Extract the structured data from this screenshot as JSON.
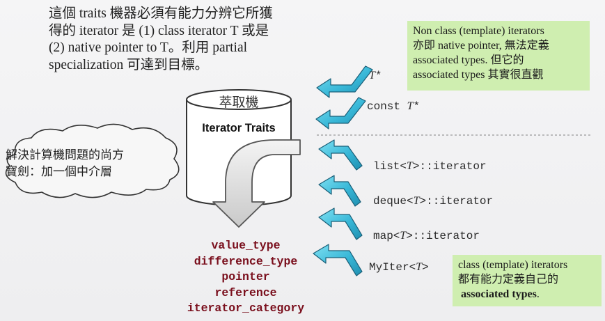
{
  "intro": {
    "lines": [
      "這個 traits 機器必須有能力分辨它所獲",
      "得的 iterator 是 (1) class iterator T 或是",
      "(2) native pointer to T。利用 partial",
      "specialization 可達到目標。"
    ]
  },
  "note_top": {
    "lines": [
      "Non class (template) iterators",
      "亦即 native pointer, 無法定義",
      "associated types. 但它的",
      "associated types 其實很直觀"
    ]
  },
  "note_bottom": {
    "line1": "class (template) iterators",
    "line2": "都有能力定義自己的",
    "line3_bold": "associated types",
    "line3_end": "."
  },
  "cylinder": {
    "title": "萃取機",
    "name": "Iterator Traits"
  },
  "cloud": {
    "lines": [
      "解決計算機問題的尚方",
      "寶劍：加一個中介層"
    ]
  },
  "pointer_labels": [
    {
      "prefix": "",
      "T": "T",
      "suffix": "*"
    },
    {
      "prefix": "const ",
      "T": "T",
      "suffix": "*"
    }
  ],
  "class_iter_labels": [
    {
      "prefix": "list<",
      "T": "T",
      "suffix": ">::iterator"
    },
    {
      "prefix": "deque<",
      "T": "T",
      "suffix": ">::iterator"
    },
    {
      "prefix": "map<",
      "T": "T",
      "suffix": ">::iterator"
    },
    {
      "prefix": "MyIter<",
      "T": "T",
      "suffix": ">"
    }
  ],
  "associated_types": [
    "value_type",
    "difference_type",
    "pointer",
    "reference",
    "iterator_category"
  ],
  "colors": {
    "arrow_fill": "#39b8d8",
    "arrow_stroke": "#1a5f78",
    "note_bg": "#cfeeb0",
    "assoc_text": "#7a0f1d"
  }
}
